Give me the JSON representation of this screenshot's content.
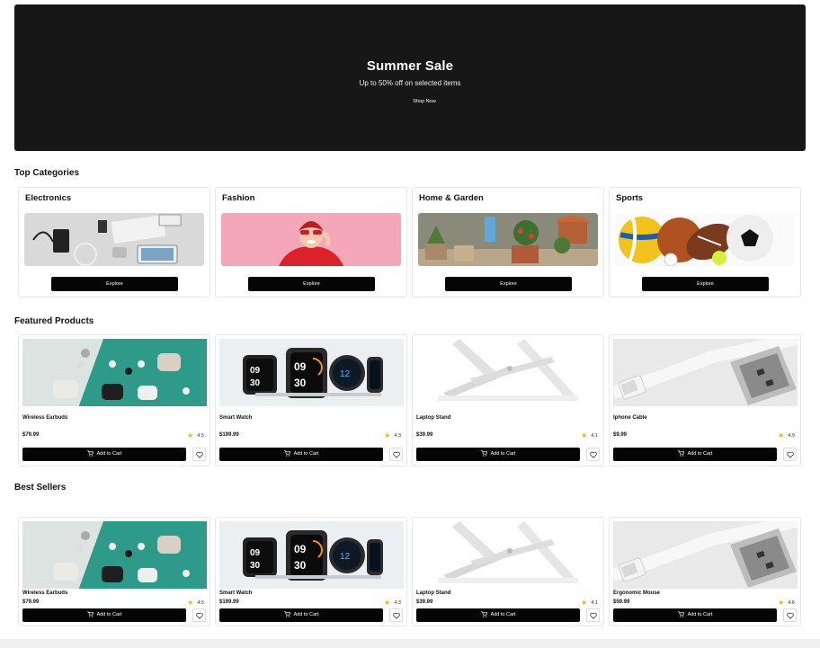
{
  "hero": {
    "title": "Summer Sale",
    "subtitle": "Up to 50% off on selected items",
    "cta": "Shop Now"
  },
  "sections": {
    "categories": "Top Categories",
    "featured": "Featured Products",
    "bestsellers": "Best Sellers"
  },
  "categories": [
    {
      "name": "Electronics",
      "button": "Explore"
    },
    {
      "name": "Fashion",
      "button": "Explore"
    },
    {
      "name": "Home & Garden",
      "button": "Explore"
    },
    {
      "name": "Sports",
      "button": "Explore"
    }
  ],
  "featured": [
    {
      "name": "Wireless Earbuds",
      "price": "$79.99",
      "rating": "4.5",
      "button": "Add to Cart"
    },
    {
      "name": "Smart Watch",
      "price": "$199.99",
      "rating": "4.3",
      "button": "Add to Cart"
    },
    {
      "name": "Laptop Stand",
      "price": "$39.99",
      "rating": "4.1",
      "button": "Add to Cart"
    },
    {
      "name": "Iphone Cable",
      "price": "$9.99",
      "rating": "4.9",
      "button": "Add to Cart"
    }
  ],
  "bestsellers": [
    {
      "name": "Wireless Earbuds",
      "price": "$79.99",
      "rating": "4.5",
      "button": "Add to Cart"
    },
    {
      "name": "Smart Watch",
      "price": "$199.99",
      "rating": "4.3",
      "button": "Add to Cart"
    },
    {
      "name": "Laptop Stand",
      "price": "$39.99",
      "rating": "4.1",
      "button": "Add to Cart"
    },
    {
      "name": "Ergonomic Mouse",
      "price": "$59.99",
      "rating": "4.6",
      "button": "Add to Cart"
    }
  ],
  "colors": {
    "hero_bg": "#171717",
    "button_bg": "#050505",
    "star": "#f5b301"
  },
  "icons": {
    "cart": "cart-icon",
    "heart": "heart-icon",
    "star": "star-icon"
  }
}
